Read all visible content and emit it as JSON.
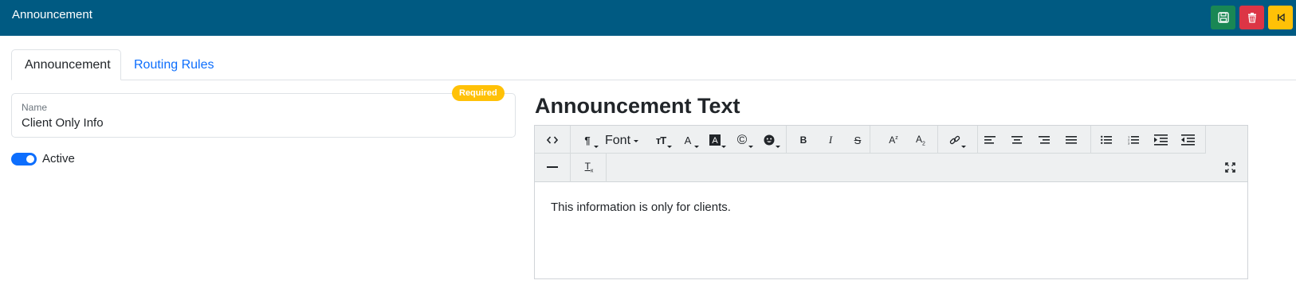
{
  "header": {
    "title": "Announcement",
    "buttons": [
      {
        "name": "save",
        "icon": "save-icon",
        "color": "#198754"
      },
      {
        "name": "delete",
        "icon": "trash-icon",
        "color": "#dc3545"
      },
      {
        "name": "back",
        "icon": "step-back-icon",
        "color": "#ffc107"
      }
    ]
  },
  "tabs": [
    {
      "label": "Announcement",
      "active": true
    },
    {
      "label": "Routing Rules",
      "active": false
    }
  ],
  "form": {
    "name_label": "Name",
    "name_value": "Client Only Info",
    "required_badge": "Required",
    "active_label": "Active",
    "active_on": true
  },
  "editor": {
    "heading": "Announcement Text",
    "font_label": "Font",
    "toolbar_row1": [
      "code-view-icon",
      "paragraph-icon",
      "font-dropdown",
      "font-size-icon",
      "font-color-icon",
      "highlight-color-icon",
      "special-char-icon",
      "emoji-icon",
      "bold-icon",
      "italic-icon",
      "strikethrough-icon",
      "superscript-icon",
      "subscript-icon",
      "link-icon",
      "align-left-icon",
      "align-center-icon",
      "align-right-icon",
      "align-justify-icon",
      "bullet-list-icon",
      "numbered-list-icon",
      "indent-icon",
      "outdent-icon"
    ],
    "toolbar_row2": [
      "horizontal-rule-icon",
      "clear-format-icon",
      "fullscreen-icon"
    ],
    "content": "This information is only for clients."
  },
  "colors": {
    "header_bg": "#005a82",
    "accent": "#0d6efd",
    "badge": "#ffc107"
  }
}
